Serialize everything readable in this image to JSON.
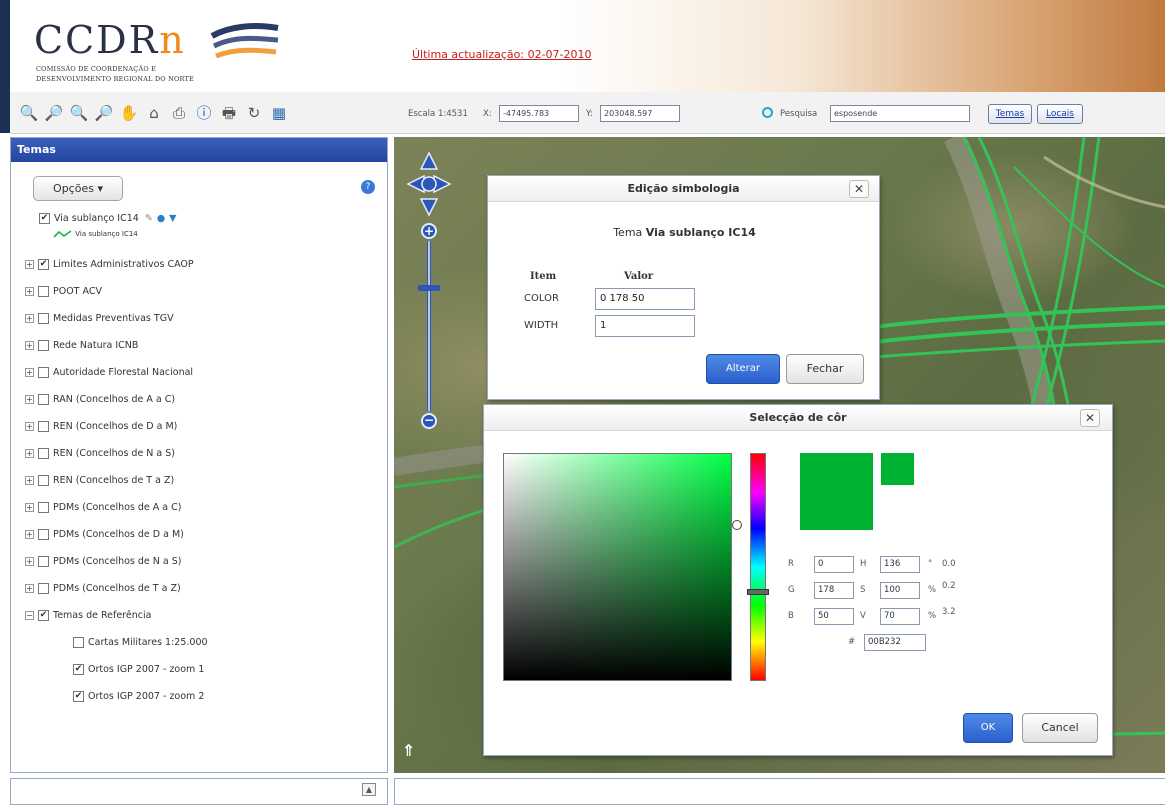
{
  "header": {
    "logo_text_main": "CCDR",
    "logo_text_n": "n",
    "logo_subtitle_1": "Comissão de Coordenação e",
    "logo_subtitle_2": "Desenvolvimento Regional do Norte",
    "update_link": "Última actualização: 02-07-2010"
  },
  "toolbar": {
    "tools": [
      "zoom-extent-icon",
      "zoom-in-icon",
      "zoom-out-icon",
      "zoom-previous-icon",
      "pan-icon",
      "home-icon",
      "print-icon",
      "info-icon",
      "print-map-icon",
      "refresh-icon",
      "layers-icon"
    ],
    "scale_label": "Escala 1:4531",
    "x_label": "X:",
    "x_value": "-47495.783",
    "y_label": "Y:",
    "y_value": "203048.597",
    "search_label": "Pesquisa",
    "search_value": "esposende",
    "temas_button": "Temas",
    "locais_button": "Locais"
  },
  "panel": {
    "title": "Temas",
    "options_button": "Opções ▾",
    "active_layer": "Via sublanço IC14",
    "active_legend": "Via sublanço IC14",
    "layers": [
      {
        "label": "Limites Administrativos CAOP",
        "checked": true
      },
      {
        "label": "POOT ACV",
        "checked": false
      },
      {
        "label": "Medidas Preventivas TGV",
        "checked": false
      },
      {
        "label": "Rede Natura ICNB",
        "checked": false
      },
      {
        "label": "Autoridade Florestal Nacional",
        "checked": false
      },
      {
        "label": "RAN (Concelhos de A a C)",
        "checked": false
      },
      {
        "label": "REN (Concelhos de D a M)",
        "checked": false
      },
      {
        "label": "REN (Concelhos de N a S)",
        "checked": false
      },
      {
        "label": "REN (Concelhos de T a Z)",
        "checked": false
      },
      {
        "label": "PDMs (Concelhos de A a C)",
        "checked": false
      },
      {
        "label": "PDMs (Concelhos de D a M)",
        "checked": false
      },
      {
        "label": "PDMs (Concelhos de N a S)",
        "checked": false
      },
      {
        "label": "PDMs (Concelhos de T a Z)",
        "checked": false
      },
      {
        "label": "Temas de Referência",
        "checked": true
      }
    ],
    "sublayers": [
      {
        "label": "Cartas Militares 1:25.000",
        "checked": false
      },
      {
        "label": "Ortos IGP 2007 - zoom 1",
        "checked": true
      },
      {
        "label": "Ortos IGP 2007 - zoom 2",
        "checked": true
      }
    ]
  },
  "symbology_dialog": {
    "title": "Edição simbologia",
    "subtitle_prefix": "Tema",
    "subtitle_name": "Via sublanço IC14",
    "col_item": "Item",
    "col_value": "Valor",
    "color_label": "COLOR",
    "color_value": "0 178 50",
    "width_label": "WIDTH",
    "width_value": "1",
    "apply_button": "Alterar",
    "close_button": "Fechar"
  },
  "color_dialog": {
    "title": "Selecção de côr",
    "r_label": "R",
    "r_value": "0",
    "g_label": "G",
    "g_value": "178",
    "b_label": "B",
    "b_value": "50",
    "h_label": "H",
    "h_value": "136",
    "s_label": "S",
    "s_value": "100",
    "v_label": "V",
    "v_value": "70",
    "deg_label": "°",
    "pct_label": "%",
    "c_value": "0.0",
    "m_value": "0.2",
    "y_value": "3.2",
    "hex_label": "#",
    "hex_value": "00B232",
    "ok_button": "OK",
    "cancel_button": "Cancel",
    "selected_color": "#00B232"
  }
}
